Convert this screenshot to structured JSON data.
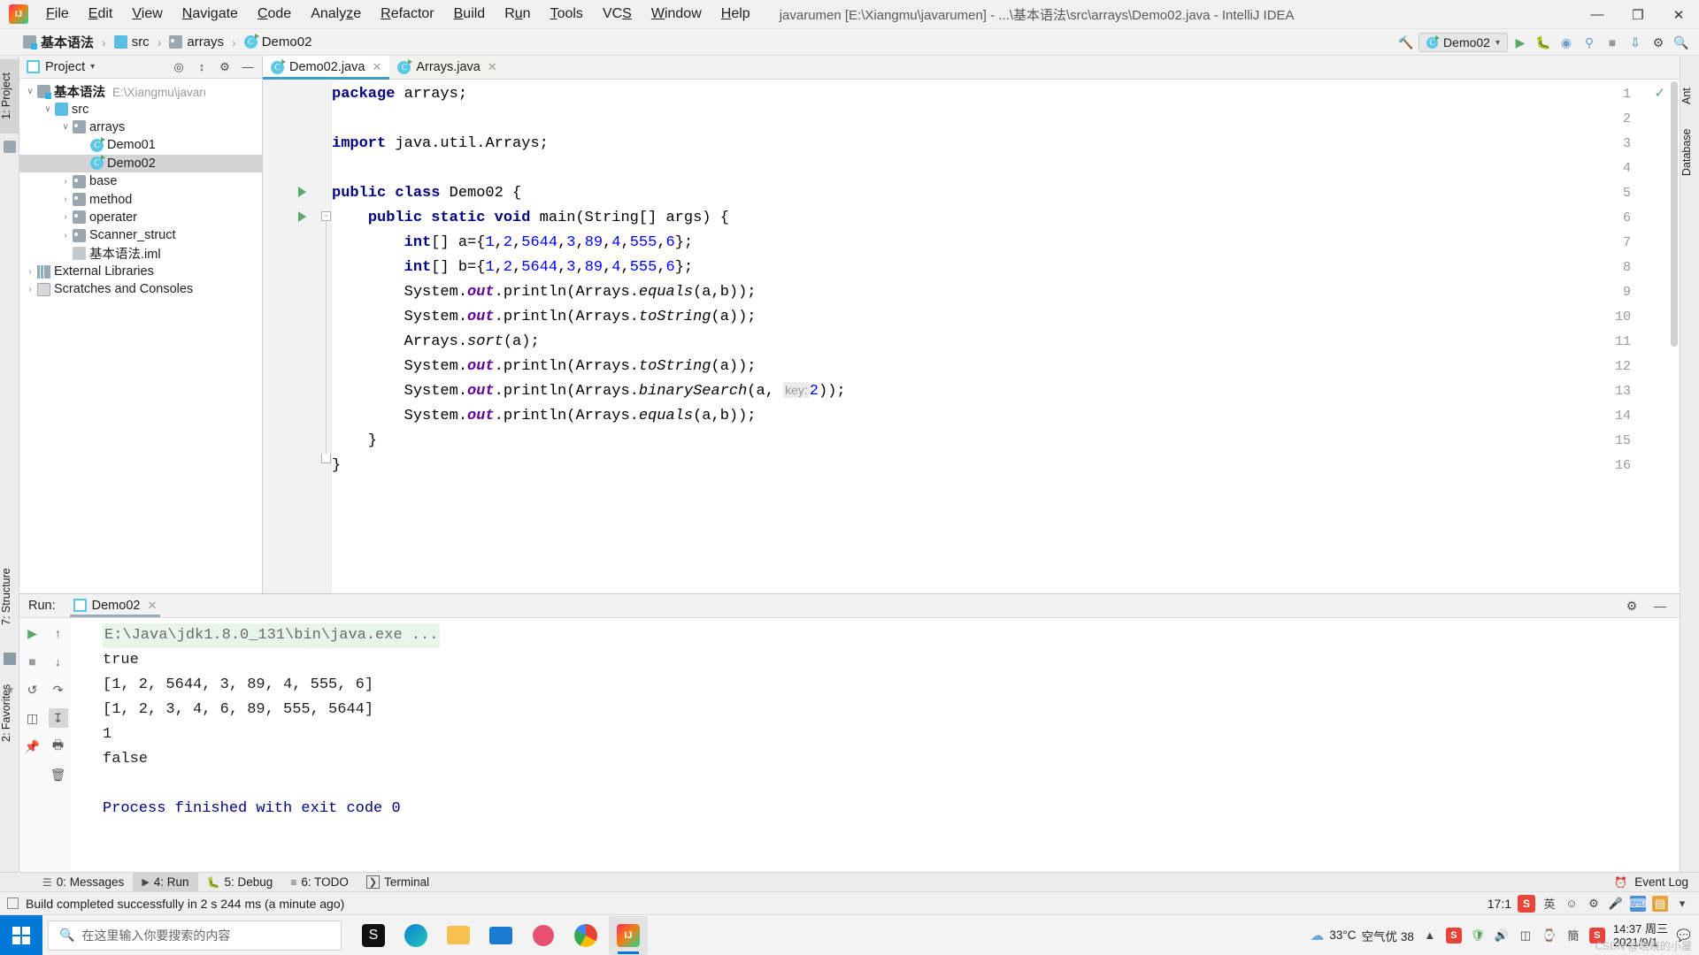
{
  "titlebar": {
    "app_icon": "intellij-logo",
    "menus": [
      "File",
      "Edit",
      "View",
      "Navigate",
      "Code",
      "Analyze",
      "Refactor",
      "Build",
      "Run",
      "Tools",
      "VCS",
      "Window",
      "Help"
    ],
    "window_title": "javarumen [E:\\Xiangmu\\javarumen] - ...\\基本语法\\src\\arrays\\Demo02.java - IntelliJ IDEA",
    "minimize": "—",
    "maximize": "❐",
    "close": "✕"
  },
  "navbar": {
    "breadcrumbs": [
      {
        "label": "基本语法",
        "icon": "module-icon"
      },
      {
        "label": "src",
        "icon": "source-folder-icon"
      },
      {
        "label": "arrays",
        "icon": "package-folder-icon"
      },
      {
        "label": "Demo02",
        "icon": "java-class-icon"
      }
    ],
    "separator": "›",
    "run_config": "Demo02",
    "run_config_caret": "▾",
    "actions": [
      "build-hammer-icon",
      "run-icon",
      "debug-icon",
      "coverage-icon",
      "profiler-icon",
      "stop-icon",
      "git-update-icon",
      "settings-icon",
      "search-everywhere-icon"
    ]
  },
  "left_strip": {
    "tabs": [
      "1: Project"
    ],
    "bottom_tabs": [
      "7: Structure",
      "2: Favorites"
    ],
    "icons": [
      "structure-icon",
      "favorites-star-icon"
    ]
  },
  "right_strip": {
    "tabs": [
      "Ant",
      "Database"
    ]
  },
  "project_panel": {
    "title": "Project",
    "title_caret": "▾",
    "header_actions": [
      "locate-icon",
      "collapse-all-icon",
      "settings-icon",
      "hide-icon"
    ],
    "tree": [
      {
        "depth": 0,
        "twist": "∨",
        "icon": "module-icon",
        "label": "基本语法",
        "bold": true,
        "path": "E:\\Xiangmu\\javarumen\\基本语法",
        "selected": false
      },
      {
        "depth": 1,
        "twist": "∨",
        "icon": "source-folder-icon",
        "label": "src",
        "bold": false,
        "path": "",
        "selected": false
      },
      {
        "depth": 2,
        "twist": "∨",
        "icon": "package-folder-icon",
        "label": "arrays",
        "bold": false,
        "path": "",
        "selected": false
      },
      {
        "depth": 3,
        "twist": "",
        "icon": "java-class-icon",
        "label": "Demo01",
        "bold": false,
        "path": "",
        "selected": false
      },
      {
        "depth": 3,
        "twist": "",
        "icon": "java-class-icon",
        "label": "Demo02",
        "bold": false,
        "path": "",
        "selected": true
      },
      {
        "depth": 2,
        "twist": "›",
        "icon": "package-folder-icon",
        "label": "base",
        "bold": false,
        "path": "",
        "selected": false
      },
      {
        "depth": 2,
        "twist": "›",
        "icon": "package-folder-icon",
        "label": "method",
        "bold": false,
        "path": "",
        "selected": false
      },
      {
        "depth": 2,
        "twist": "›",
        "icon": "package-folder-icon",
        "label": "operater",
        "bold": false,
        "path": "",
        "selected": false
      },
      {
        "depth": 2,
        "twist": "›",
        "icon": "package-folder-icon",
        "label": "Scanner_struct",
        "bold": false,
        "path": "",
        "selected": false
      },
      {
        "depth": 1,
        "twist": "",
        "icon": "iml-file-icon",
        "label": "基本语法.iml",
        "bold": false,
        "path": "",
        "selected": false
      },
      {
        "depth": 0,
        "twist": "›",
        "icon": "library-icon",
        "label": "External Libraries",
        "bold": false,
        "path": "",
        "selected": false
      },
      {
        "depth": 0,
        "twist": "›",
        "icon": "console-icon",
        "label": "Scratches and Consoles",
        "bold": false,
        "path": "",
        "selected": false
      }
    ]
  },
  "editor": {
    "tabs": [
      {
        "label": "Demo02.java",
        "active": true,
        "icon": "java-class-icon",
        "close": "✕"
      },
      {
        "label": "Arrays.java",
        "active": false,
        "icon": "java-class-library-icon",
        "close": "✕"
      }
    ],
    "inspection_status": "✓",
    "lines": [
      {
        "num": "1",
        "run": false,
        "fold": false,
        "tokens": [
          {
            "t": "package ",
            "c": "k"
          },
          {
            "t": "arrays;",
            "c": "t"
          }
        ]
      },
      {
        "num": "2",
        "run": false,
        "fold": false,
        "tokens": []
      },
      {
        "num": "3",
        "run": false,
        "fold": false,
        "tokens": [
          {
            "t": "import ",
            "c": "k"
          },
          {
            "t": "java.util.Arrays;",
            "c": "t"
          }
        ]
      },
      {
        "num": "4",
        "run": false,
        "fold": false,
        "tokens": []
      },
      {
        "num": "5",
        "run": true,
        "fold": false,
        "tokens": [
          {
            "t": "public class ",
            "c": "k"
          },
          {
            "t": "Demo02 {",
            "c": "t"
          }
        ]
      },
      {
        "num": "6",
        "run": true,
        "fold": true,
        "tokens": [
          {
            "t": "    ",
            "c": "t"
          },
          {
            "t": "public static void ",
            "c": "k"
          },
          {
            "t": "main(String[] args) {",
            "c": "t"
          }
        ]
      },
      {
        "num": "7",
        "run": false,
        "fold": false,
        "tokens": [
          {
            "t": "        ",
            "c": "t"
          },
          {
            "t": "int",
            "c": "k"
          },
          {
            "t": "[] a={",
            "c": "t"
          },
          {
            "t": "1",
            "c": "n"
          },
          {
            "t": ",",
            "c": "t"
          },
          {
            "t": "2",
            "c": "n"
          },
          {
            "t": ",",
            "c": "t"
          },
          {
            "t": "5644",
            "c": "n"
          },
          {
            "t": ",",
            "c": "t"
          },
          {
            "t": "3",
            "c": "n"
          },
          {
            "t": ",",
            "c": "t"
          },
          {
            "t": "89",
            "c": "n"
          },
          {
            "t": ",",
            "c": "t"
          },
          {
            "t": "4",
            "c": "n"
          },
          {
            "t": ",",
            "c": "t"
          },
          {
            "t": "555",
            "c": "n"
          },
          {
            "t": ",",
            "c": "t"
          },
          {
            "t": "6",
            "c": "n"
          },
          {
            "t": "};",
            "c": "t"
          }
        ]
      },
      {
        "num": "8",
        "run": false,
        "fold": false,
        "tokens": [
          {
            "t": "        ",
            "c": "t"
          },
          {
            "t": "int",
            "c": "k"
          },
          {
            "t": "[] b={",
            "c": "t"
          },
          {
            "t": "1",
            "c": "n"
          },
          {
            "t": ",",
            "c": "t"
          },
          {
            "t": "2",
            "c": "n"
          },
          {
            "t": ",",
            "c": "t"
          },
          {
            "t": "5644",
            "c": "n"
          },
          {
            "t": ",",
            "c": "t"
          },
          {
            "t": "3",
            "c": "n"
          },
          {
            "t": ",",
            "c": "t"
          },
          {
            "t": "89",
            "c": "n"
          },
          {
            "t": ",",
            "c": "t"
          },
          {
            "t": "4",
            "c": "n"
          },
          {
            "t": ",",
            "c": "t"
          },
          {
            "t": "555",
            "c": "n"
          },
          {
            "t": ",",
            "c": "t"
          },
          {
            "t": "6",
            "c": "n"
          },
          {
            "t": "};",
            "c": "t"
          }
        ]
      },
      {
        "num": "9",
        "run": false,
        "fold": false,
        "tokens": [
          {
            "t": "        System.",
            "c": "t"
          },
          {
            "t": "out",
            "c": "sf"
          },
          {
            "t": ".println(Arrays.",
            "c": "t"
          },
          {
            "t": "equals",
            "c": "f"
          },
          {
            "t": "(a,b));",
            "c": "t"
          }
        ]
      },
      {
        "num": "10",
        "run": false,
        "fold": false,
        "tokens": [
          {
            "t": "        System.",
            "c": "t"
          },
          {
            "t": "out",
            "c": "sf"
          },
          {
            "t": ".println(Arrays.",
            "c": "t"
          },
          {
            "t": "toString",
            "c": "f"
          },
          {
            "t": "(a));",
            "c": "t"
          }
        ]
      },
      {
        "num": "11",
        "run": false,
        "fold": false,
        "tokens": [
          {
            "t": "        Arrays.",
            "c": "t"
          },
          {
            "t": "sort",
            "c": "f"
          },
          {
            "t": "(a);",
            "c": "t"
          }
        ]
      },
      {
        "num": "12",
        "run": false,
        "fold": false,
        "tokens": [
          {
            "t": "        System.",
            "c": "t"
          },
          {
            "t": "out",
            "c": "sf"
          },
          {
            "t": ".println(Arrays.",
            "c": "t"
          },
          {
            "t": "toString",
            "c": "f"
          },
          {
            "t": "(a));",
            "c": "t"
          }
        ]
      },
      {
        "num": "13",
        "run": false,
        "fold": false,
        "hint": "key:",
        "hint_value": "2",
        "tokens": [
          {
            "t": "        System.",
            "c": "t"
          },
          {
            "t": "out",
            "c": "sf"
          },
          {
            "t": ".println(Arrays.",
            "c": "t"
          },
          {
            "t": "binarySearch",
            "c": "f"
          },
          {
            "t": "(a, ",
            "c": "t"
          }
        ],
        "tokens_after": [
          {
            "t": "));",
            "c": "t"
          }
        ]
      },
      {
        "num": "14",
        "run": false,
        "fold": false,
        "tokens": [
          {
            "t": "        System.",
            "c": "t"
          },
          {
            "t": "out",
            "c": "sf"
          },
          {
            "t": ".println(Arrays.",
            "c": "t"
          },
          {
            "t": "equals",
            "c": "f"
          },
          {
            "t": "(a,b));",
            "c": "t"
          }
        ]
      },
      {
        "num": "15",
        "run": false,
        "fold": true,
        "tokens": [
          {
            "t": "    }",
            "c": "t"
          }
        ]
      },
      {
        "num": "16",
        "run": false,
        "fold": false,
        "tokens": [
          {
            "t": "}",
            "c": "t"
          }
        ]
      }
    ]
  },
  "run_panel": {
    "label": "Run:",
    "tab": "Demo02",
    "tab_close": "✕",
    "sidebar_buttons": [
      "rerun-icon",
      "stop-icon",
      "rerun-failed-icon",
      "toggle-tasks-icon",
      "pin-icon",
      "scroll-up-icon",
      "scroll-down-icon",
      "soft-wrap-icon",
      "scroll-to-end-icon",
      "print-icon",
      "clear-all-icon"
    ],
    "header_actions": [
      "settings-gear-icon",
      "hide-icon"
    ],
    "console": [
      {
        "text": "E:\\Java\\jdk1.8.0_131\\bin\\java.exe ...",
        "style": "cmd"
      },
      {
        "text": "true",
        "style": "out"
      },
      {
        "text": "[1, 2, 5644, 3, 89, 4, 555, 6]",
        "style": "out"
      },
      {
        "text": "[1, 2, 3, 4, 6, 89, 555, 5644]",
        "style": "out"
      },
      {
        "text": "1",
        "style": "out"
      },
      {
        "text": "false",
        "style": "out"
      },
      {
        "text": "",
        "style": "out"
      },
      {
        "text": "Process finished with exit code 0",
        "style": "exit"
      }
    ]
  },
  "bottom_tabs": {
    "items": [
      {
        "label": "0: Messages",
        "icon": "messages-icon",
        "selected": false
      },
      {
        "label": "4: Run",
        "icon": "run-icon",
        "selected": true
      },
      {
        "label": "5: Debug",
        "icon": "debug-icon",
        "selected": false
      },
      {
        "label": "6: TODO",
        "icon": "todo-icon",
        "selected": false
      },
      {
        "label": "Terminal",
        "icon": "terminal-icon",
        "selected": false
      }
    ],
    "event_log": "Event Log",
    "event_log_icon": "event-log-icon"
  },
  "statusbar": {
    "message": "Build completed successfully in 2 s 244 ms (a minute ago)",
    "message_icon": "build-status-icon",
    "caret_position": "17:1",
    "ime_label": "S",
    "ime_mode": "英",
    "tray_icons": [
      "ime-s-icon",
      "ime-lang-icon",
      "smiley-icon",
      "settings-icon",
      "mic-icon",
      "keyboard-icon",
      "toolbox-icon",
      "more-icon"
    ]
  },
  "taskbar": {
    "start_label": "start-windows-icon",
    "search_placeholder": "在这里输入你要搜索的内容",
    "search_icon": "search-icon",
    "apps": [
      {
        "name": "xmind-icon",
        "active": false
      },
      {
        "name": "edge-icon",
        "active": false
      },
      {
        "name": "file-explorer-icon",
        "active": false
      },
      {
        "name": "mail-icon",
        "active": false
      },
      {
        "name": "snip-tool-icon",
        "active": false
      },
      {
        "name": "chrome-icon",
        "active": false
      },
      {
        "name": "intellij-idea-icon",
        "active": true
      }
    ],
    "weather_temp": "33°C",
    "weather_air": "空气优 38",
    "weather_icon": "cloud-icon",
    "tray": [
      "cloud-weather-icon",
      "sogou-icon",
      "shield-icon",
      "volume-icon",
      "battery-icon",
      "network-icon",
      "chinese-ime-icon",
      "sogou-red-icon"
    ],
    "clock_time": "14:37 周三",
    "clock_date": "2021/9/1",
    "notify_icon": "notification-icon",
    "watermark": "CSDN @晓晓的小屋"
  }
}
